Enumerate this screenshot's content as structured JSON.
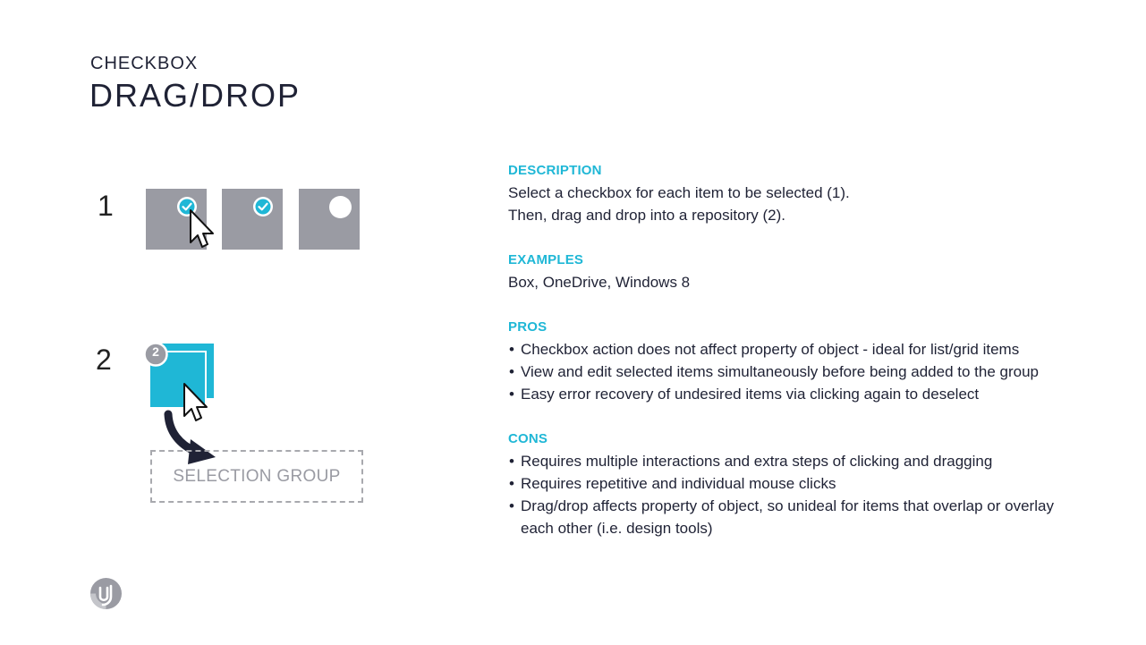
{
  "header": {
    "subtitle": "CHECKBOX",
    "title": "DRAG/DROP"
  },
  "illustration": {
    "step1_label": "1",
    "step2_label": "2",
    "stack_count_badge": "2",
    "selection_group_label": "SELECTION GROUP",
    "tile_color": "#9a9ba3",
    "accent_color": "#1fb7d6",
    "tiles": [
      {
        "state": "checked"
      },
      {
        "state": "checked"
      },
      {
        "state": "unchecked"
      }
    ]
  },
  "details": {
    "description_heading": "DESCRIPTION",
    "description_lines": [
      "Select a checkbox for each item to be selected (1).",
      "Then, drag and drop into a repository (2)."
    ],
    "examples_heading": "EXAMPLES",
    "examples_text": "Box, OneDrive, Windows 8",
    "pros_heading": "PROS",
    "pros": [
      "Checkbox action does not affect property of object - ideal for list/grid items",
      "View and edit selected items simultaneously before being added to the group",
      "Easy error recovery of undesired items via clicking again to deselect"
    ],
    "cons_heading": "CONS",
    "cons": [
      "Requires multiple interactions and extra steps of clicking and dragging",
      "Requires repetitive and individual mouse clicks",
      "Drag/drop affects property of object, so unideal for items that overlap or overlay each other (i.e. design tools)"
    ]
  },
  "footer": {
    "logo_icon": "brand-logo-icon"
  }
}
